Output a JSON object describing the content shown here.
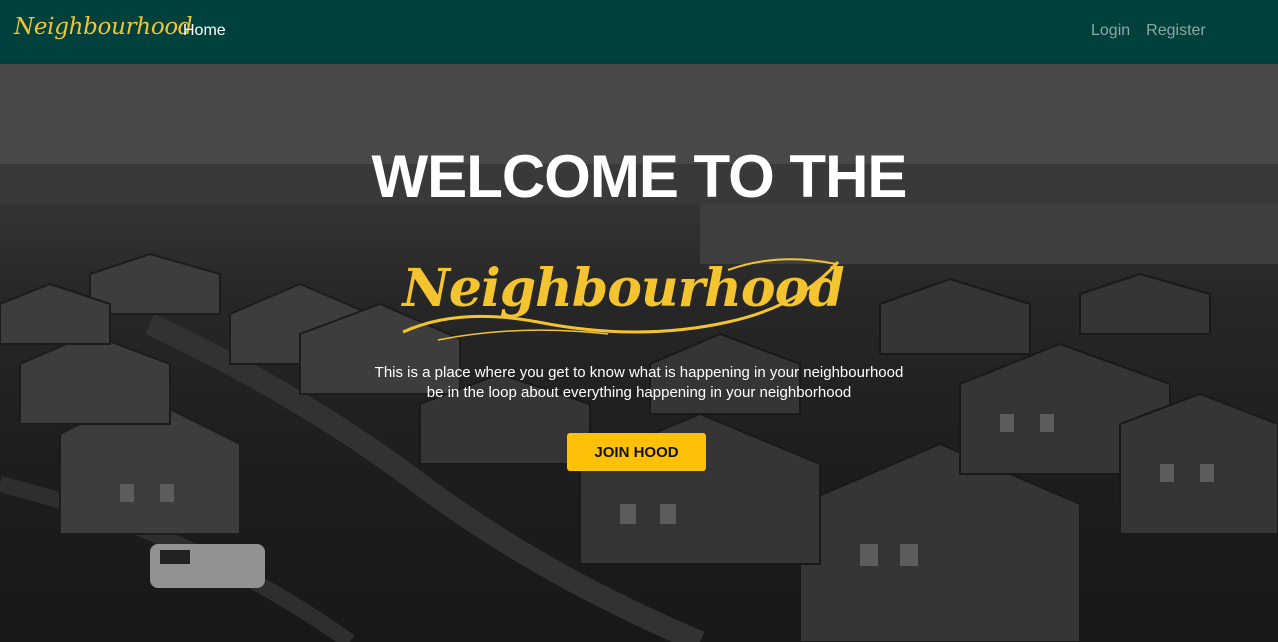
{
  "navbar": {
    "brand": "Neighbourhood",
    "home": "Home",
    "login": "Login",
    "register": "Register"
  },
  "hero": {
    "title": "WELCOME TO THE",
    "script_title": "Neighbourhood",
    "tagline_line1": "This is a place where you get to know what is happening in your neighbourhood",
    "tagline_line2": "be in the loop about everything happening in your neighborhood",
    "cta": "JOIN HOOD"
  },
  "colors": {
    "navbar_bg": "#00413e",
    "accent": "#f4c430",
    "button": "#ffc107"
  }
}
